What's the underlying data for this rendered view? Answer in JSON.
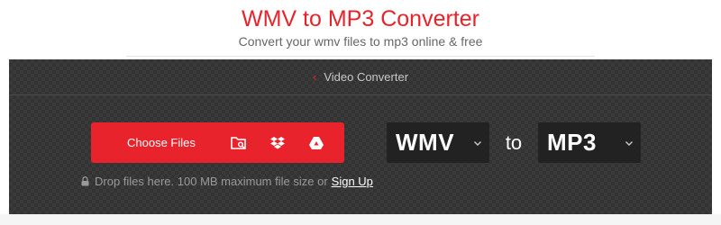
{
  "header": {
    "title": "WMV to MP3 Converter",
    "subtitle": "Convert your wmv files to mp3 online & free"
  },
  "breadcrumb": {
    "label": "Video Converter",
    "icon": "chevron-left-icon"
  },
  "upload": {
    "choose_label": "Choose Files",
    "sources": [
      {
        "name": "local-folder",
        "icon": "folder-search-icon"
      },
      {
        "name": "dropbox",
        "icon": "dropbox-icon"
      },
      {
        "name": "google-drive",
        "icon": "google-drive-icon"
      }
    ],
    "hint": "Drop files here. 100 MB maximum file size or",
    "signup_label": "Sign Up"
  },
  "converter": {
    "from": "WMV",
    "connector": "to",
    "to": "MP3"
  },
  "colors": {
    "accent": "#e8232b",
    "panel": "#3a3a3a",
    "select_bg": "#222222"
  }
}
